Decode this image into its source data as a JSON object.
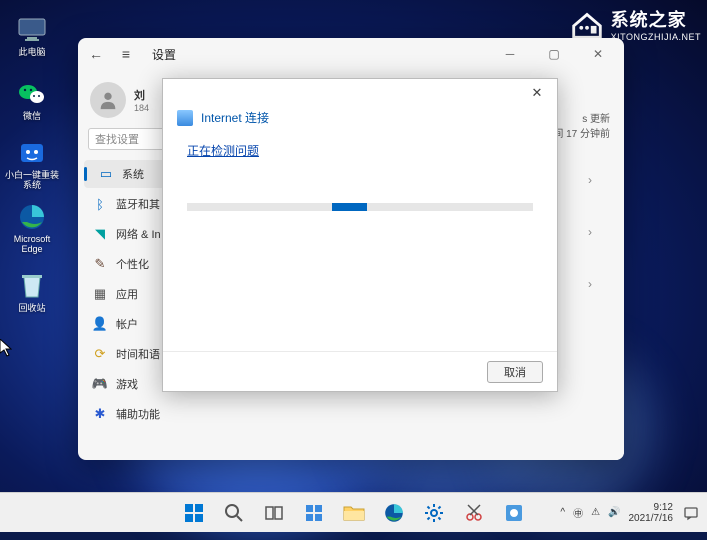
{
  "watermark": {
    "cn": "系统之家",
    "en": "XITONGZHIJIA.NET"
  },
  "desktop_icons": [
    {
      "name": "this-pc",
      "label": "此电脑"
    },
    {
      "name": "wechat",
      "label": "微信"
    },
    {
      "name": "xiaobai",
      "label": "小白一键重装系统"
    },
    {
      "name": "edge",
      "label": "Microsoft Edge"
    },
    {
      "name": "recycle",
      "label": "回收站"
    }
  ],
  "settings": {
    "title": "设置",
    "user": {
      "name": "刘",
      "sub": "184"
    },
    "search_placeholder": "查找设置",
    "nav": [
      {
        "icon": "system",
        "label": "系统",
        "active": true
      },
      {
        "icon": "bluetooth",
        "label": "蓝牙和其"
      },
      {
        "icon": "wifi",
        "label": "网络 & In"
      },
      {
        "icon": "personalize",
        "label": "个性化"
      },
      {
        "icon": "apps",
        "label": "应用"
      },
      {
        "icon": "accounts",
        "label": "帐户"
      },
      {
        "icon": "time",
        "label": "时间和语"
      },
      {
        "icon": "gaming",
        "label": "游戏"
      },
      {
        "icon": "accessibility",
        "label": "辅助功能"
      }
    ],
    "update": {
      "line1": "s 更新",
      "line2": "间 17 分钟前"
    }
  },
  "dialog": {
    "title": "Internet 连接",
    "status": "正在检测问题",
    "cancel": "取消"
  },
  "taskbar": {
    "time": "9:12",
    "date": "2021/7/16"
  }
}
